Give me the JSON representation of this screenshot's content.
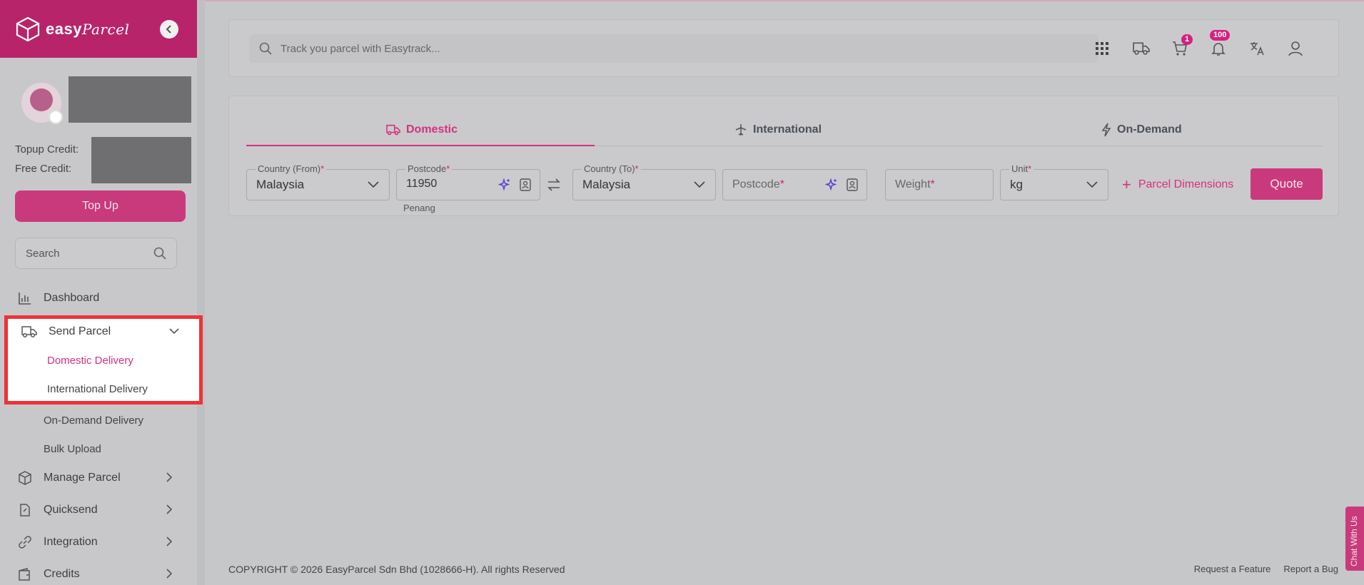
{
  "brand": {
    "name": "easy",
    "name_italic": "Parcel"
  },
  "sidebar": {
    "topup_credit_label": "Topup Credit:",
    "free_credit_label": "Free Credit:",
    "topup_button": "Top Up",
    "search_placeholder": "Search",
    "nav": {
      "dashboard": "Dashboard",
      "send_parcel": "Send Parcel",
      "domestic_delivery": "Domestic Delivery",
      "international_delivery": "International Delivery",
      "on_demand_delivery": "On-Demand Delivery",
      "bulk_upload": "Bulk Upload",
      "manage_parcel": "Manage Parcel",
      "quicksend": "Quicksend",
      "integration": "Integration",
      "credits": "Credits"
    }
  },
  "topbar": {
    "track_placeholder": "Track you parcel with Easytrack...",
    "cart_badge": "1",
    "notification_badge": "100"
  },
  "quote": {
    "tabs": {
      "domestic": "Domestic",
      "international": "International",
      "on_demand": "On-Demand"
    },
    "country_from_label": "Country (From)",
    "country_from_value": "Malaysia",
    "postcode_from_label": "Postcode",
    "postcode_from_value": "11950",
    "postcode_from_hint": "Penang",
    "country_to_label": "Country (To)",
    "country_to_value": "Malaysia",
    "postcode_to_placeholder": "Postcode",
    "weight_placeholder": "Weight",
    "unit_label": "Unit",
    "unit_value": "kg",
    "required_mark": "*",
    "parcel_dimensions": "Parcel Dimensions",
    "quote_button": "Quote"
  },
  "footer": {
    "copyright": "COPYRIGHT © 2026 EasyParcel Sdn Bhd (1028666-H). All rights Reserved",
    "request_feature": "Request a Feature",
    "report_bug": "Report a Bug"
  },
  "chat": {
    "label": "Chat With Us"
  },
  "colors": {
    "accent": "#d6307f",
    "brand": "#b8246a",
    "highlight": "#ef3236"
  }
}
